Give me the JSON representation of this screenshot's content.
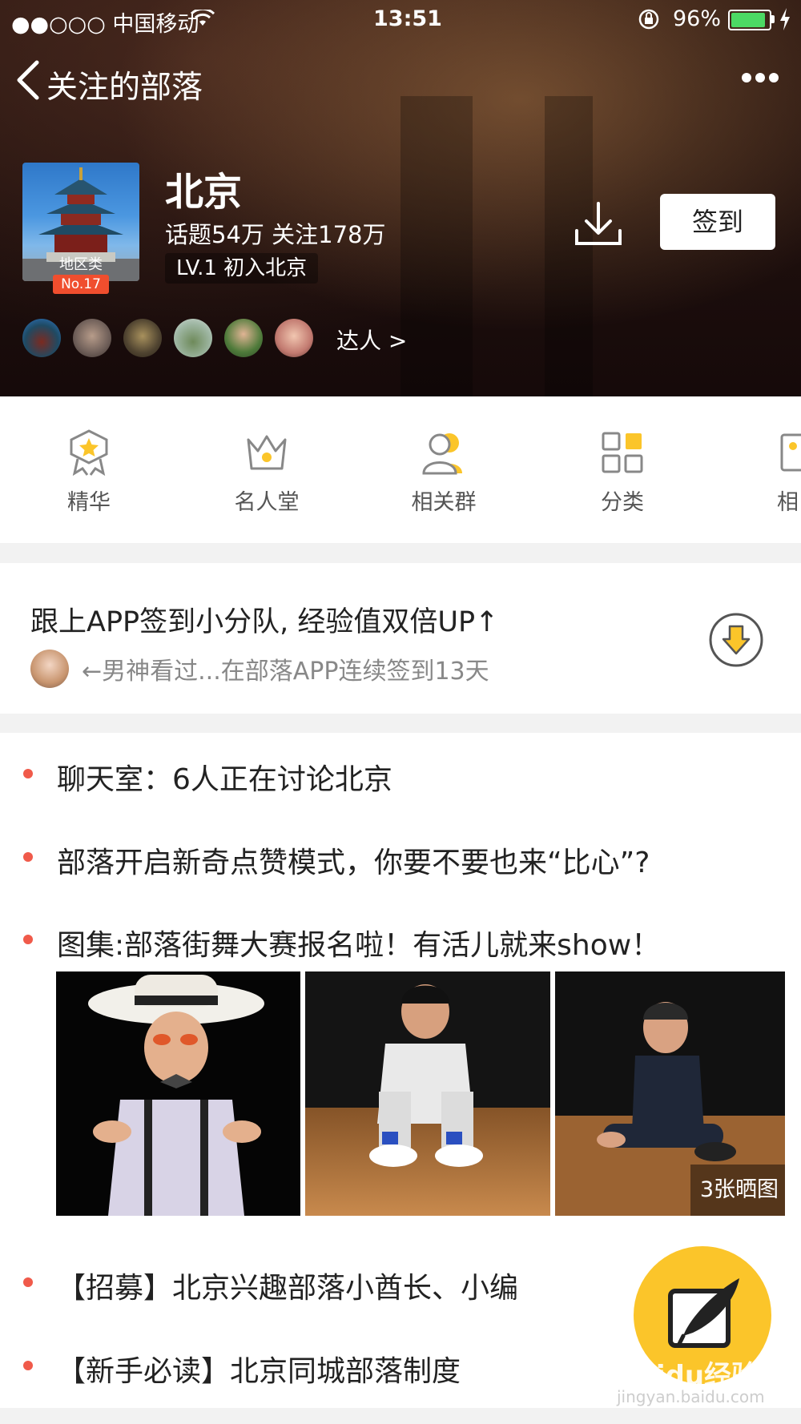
{
  "status_bar": {
    "carrier": "●●○○○ 中国移动",
    "time": "13:51",
    "battery": "96%"
  },
  "nav": {
    "title": "关注的部落"
  },
  "tribe": {
    "name": "北京",
    "stats": "话题54万  关注178万",
    "level": "LV.1 初入北京",
    "category": "地区类",
    "rank": "No.17",
    "checkin_label": "签到",
    "experts_link": "达人  >"
  },
  "quick_nav": [
    {
      "label": "精华",
      "icon": "star-badge-icon"
    },
    {
      "label": "名人堂",
      "icon": "crown-icon"
    },
    {
      "label": "相关群",
      "icon": "group-icon"
    },
    {
      "label": "分类",
      "icon": "grid-icon"
    },
    {
      "label": "相",
      "icon": "image-icon"
    }
  ],
  "promo": {
    "title": "跟上APP签到小分队, 经验值双倍UP↑",
    "subtitle": "←男神看过...在部落APP连续签到13天"
  },
  "feed": [
    {
      "text": "聊天室：6人正在讨论北京"
    },
    {
      "text": "部落开启新奇点赞模式，你要不要也来“比心”?"
    },
    {
      "text": "图集:部落街舞大赛报名啦！有活儿就来show！"
    },
    {
      "text": "【招募】北京兴趣部落小酋长、小编"
    },
    {
      "text": "【新手必读】北京同城部落制度"
    }
  ],
  "gallery_badge": "3张晒图",
  "watermark": {
    "brand": "Baidu经验",
    "url": "jingyan.baidu.com"
  },
  "colors": {
    "accent": "#fbc52a",
    "bullet": "#f05a4a",
    "rank_badge": "#f04e2e",
    "battery": "#4cd964"
  }
}
